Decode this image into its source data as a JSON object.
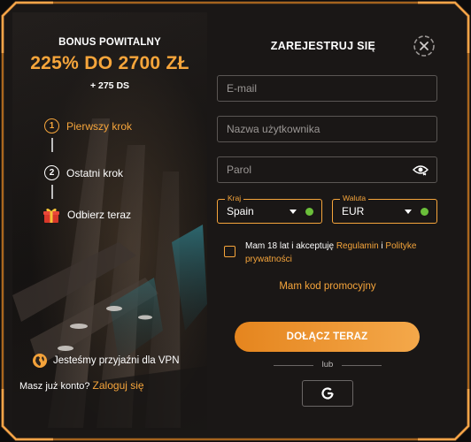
{
  "promo": {
    "bonus_subtitle": "BONUS POWITALNY",
    "bonus_amount": "225% DO 2700 ZŁ",
    "bonus_extra": "+ 275 DS"
  },
  "steps": [
    {
      "number": "1",
      "label": "Pierwszy krok"
    },
    {
      "number": "2",
      "label": "Ostatni krok"
    },
    {
      "label": "Odbierz teraz",
      "icon": "gift-icon"
    }
  ],
  "vpn_text": "Jesteśmy przyjaźni dla VPN",
  "login": {
    "text": "Masz już konto?",
    "link": "Zaloguj się"
  },
  "form": {
    "title": "ZAREJESTRUJ SIĘ",
    "email_placeholder": "E-mail",
    "username_placeholder": "Nazwa użytkownika",
    "password_placeholder": "Parol",
    "country": {
      "legend": "Kraj",
      "value": "Spain"
    },
    "currency": {
      "legend": "Waluta",
      "value": "EUR"
    },
    "terms": {
      "prefix": "Mam 18 lat i akceptuję ",
      "regulations": "Regulamin",
      "middle": " i ",
      "privacy": "Polityke prywatności"
    },
    "promo_code": "Mam kod promocyjny",
    "join_button": "DOŁĄCZ TERAZ",
    "divider": "lub",
    "google_icon": "google-icon"
  },
  "colors": {
    "accent": "#f6a53b",
    "background": "#1a1716",
    "success": "#6bbf3a"
  }
}
